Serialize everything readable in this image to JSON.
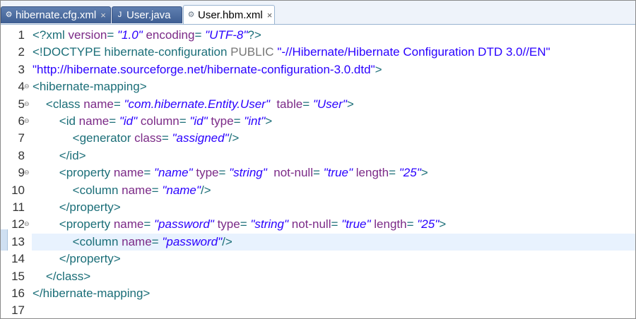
{
  "tabs": [
    {
      "label": "hibernate.cfg.xml",
      "icon": "xml-file-icon",
      "state": "inactive",
      "close": "×"
    },
    {
      "label": "User.java",
      "icon": "java-file-icon",
      "state": "inactive",
      "close": ""
    },
    {
      "label": "User.hbm.xml",
      "icon": "xml-file-icon",
      "state": "active",
      "close": "×"
    }
  ],
  "lines": [
    {
      "n": "1",
      "fold": "",
      "current": false,
      "tokens": [
        [
          "t",
          "<?xml "
        ],
        [
          "a",
          "version"
        ],
        [
          "t",
          "= "
        ],
        [
          "v",
          "\"1.0\""
        ],
        [
          "t",
          " "
        ],
        [
          "a",
          "encoding"
        ],
        [
          "t",
          "= "
        ],
        [
          "v",
          "\"UTF-8\""
        ],
        [
          "t",
          "?>"
        ]
      ]
    },
    {
      "n": "2",
      "fold": "",
      "current": false,
      "tokens": [
        [
          "t",
          "<!DOCTYPE hibernate-configuration "
        ],
        [
          "k",
          "PUBLIC"
        ],
        [
          "t",
          " "
        ],
        [
          "s",
          "\"-//Hibernate/Hibernate Configuration DTD 3.0//EN\""
        ]
      ]
    },
    {
      "n": "3",
      "fold": "",
      "current": false,
      "tokens": [
        [
          "s",
          "\"http://hibernate.sourceforge.net/hibernate-configuration-3.0.dtd\""
        ],
        [
          "t",
          ">"
        ]
      ]
    },
    {
      "n": "4",
      "fold": "⊖",
      "current": false,
      "tokens": [
        [
          "t",
          "<hibernate-mapping>"
        ]
      ]
    },
    {
      "n": "5",
      "fold": "⊖",
      "current": false,
      "tokens": [
        [
          "t",
          "    <class "
        ],
        [
          "a",
          "name"
        ],
        [
          "t",
          "= "
        ],
        [
          "v",
          "\"com.hibernate.Entity.User\""
        ],
        [
          "t",
          "  "
        ],
        [
          "a",
          "table"
        ],
        [
          "t",
          "= "
        ],
        [
          "v",
          "\"User\""
        ],
        [
          "t",
          ">"
        ]
      ]
    },
    {
      "n": "6",
      "fold": "⊖",
      "current": false,
      "tokens": [
        [
          "t",
          "        <id "
        ],
        [
          "a",
          "name"
        ],
        [
          "t",
          "= "
        ],
        [
          "v",
          "\"id\""
        ],
        [
          "t",
          " "
        ],
        [
          "a",
          "column"
        ],
        [
          "t",
          "= "
        ],
        [
          "v",
          "\"id\""
        ],
        [
          "t",
          " "
        ],
        [
          "a",
          "type"
        ],
        [
          "t",
          "= "
        ],
        [
          "v",
          "\"int\""
        ],
        [
          "t",
          ">"
        ]
      ]
    },
    {
      "n": "7",
      "fold": "",
      "current": false,
      "tokens": [
        [
          "t",
          "            <generator "
        ],
        [
          "a",
          "class"
        ],
        [
          "t",
          "= "
        ],
        [
          "v",
          "\"assigned\""
        ],
        [
          "t",
          "/>"
        ]
      ]
    },
    {
      "n": "8",
      "fold": "",
      "current": false,
      "tokens": [
        [
          "t",
          "        </id>"
        ]
      ]
    },
    {
      "n": "9",
      "fold": "⊖",
      "current": false,
      "tokens": [
        [
          "t",
          "        <property "
        ],
        [
          "a",
          "name"
        ],
        [
          "t",
          "= "
        ],
        [
          "v",
          "\"name\""
        ],
        [
          "t",
          " "
        ],
        [
          "a",
          "type"
        ],
        [
          "t",
          "= "
        ],
        [
          "v",
          "\"string\""
        ],
        [
          "t",
          "  "
        ],
        [
          "a",
          "not-null"
        ],
        [
          "t",
          "= "
        ],
        [
          "v",
          "\"true\""
        ],
        [
          "t",
          " "
        ],
        [
          "a",
          "length"
        ],
        [
          "t",
          "= "
        ],
        [
          "v",
          "\"25\""
        ],
        [
          "t",
          ">"
        ]
      ]
    },
    {
      "n": "10",
      "fold": "",
      "current": false,
      "tokens": [
        [
          "t",
          "            <column "
        ],
        [
          "a",
          "name"
        ],
        [
          "t",
          "= "
        ],
        [
          "v",
          "\"name\""
        ],
        [
          "t",
          "/>"
        ]
      ]
    },
    {
      "n": "11",
      "fold": "",
      "current": false,
      "tokens": [
        [
          "t",
          "        </property>"
        ]
      ]
    },
    {
      "n": "12",
      "fold": "⊖",
      "current": false,
      "tokens": [
        [
          "t",
          "        <property "
        ],
        [
          "a",
          "name"
        ],
        [
          "t",
          "= "
        ],
        [
          "v",
          "\"password\""
        ],
        [
          "t",
          " "
        ],
        [
          "a",
          "type"
        ],
        [
          "t",
          "= "
        ],
        [
          "v",
          "\"string\""
        ],
        [
          "t",
          " "
        ],
        [
          "a",
          "not-null"
        ],
        [
          "t",
          "= "
        ],
        [
          "v",
          "\"true\""
        ],
        [
          "t",
          " "
        ],
        [
          "a",
          "length"
        ],
        [
          "t",
          "= "
        ],
        [
          "v",
          "\"25\""
        ],
        [
          "t",
          ">"
        ]
      ]
    },
    {
      "n": "13",
      "fold": "",
      "current": true,
      "tokens": [
        [
          "t",
          "            <column "
        ],
        [
          "a",
          "name"
        ],
        [
          "t",
          "= "
        ],
        [
          "v",
          "\"password\""
        ],
        [
          "t",
          "/>"
        ]
      ]
    },
    {
      "n": "14",
      "fold": "",
      "current": false,
      "tokens": [
        [
          "t",
          "        </property>"
        ]
      ]
    },
    {
      "n": "15",
      "fold": "",
      "current": false,
      "tokens": [
        [
          "t",
          "    </class>"
        ]
      ]
    },
    {
      "n": "16",
      "fold": "",
      "current": false,
      "tokens": [
        [
          "t",
          "</hibernate-mapping>"
        ]
      ]
    },
    {
      "n": "17",
      "fold": "",
      "current": false,
      "tokens": []
    }
  ],
  "colors": {
    "tag": "#1b6e78",
    "attribute": "#7b2a87",
    "value": "#2a00ff",
    "current_line": "#e8f2fe"
  }
}
